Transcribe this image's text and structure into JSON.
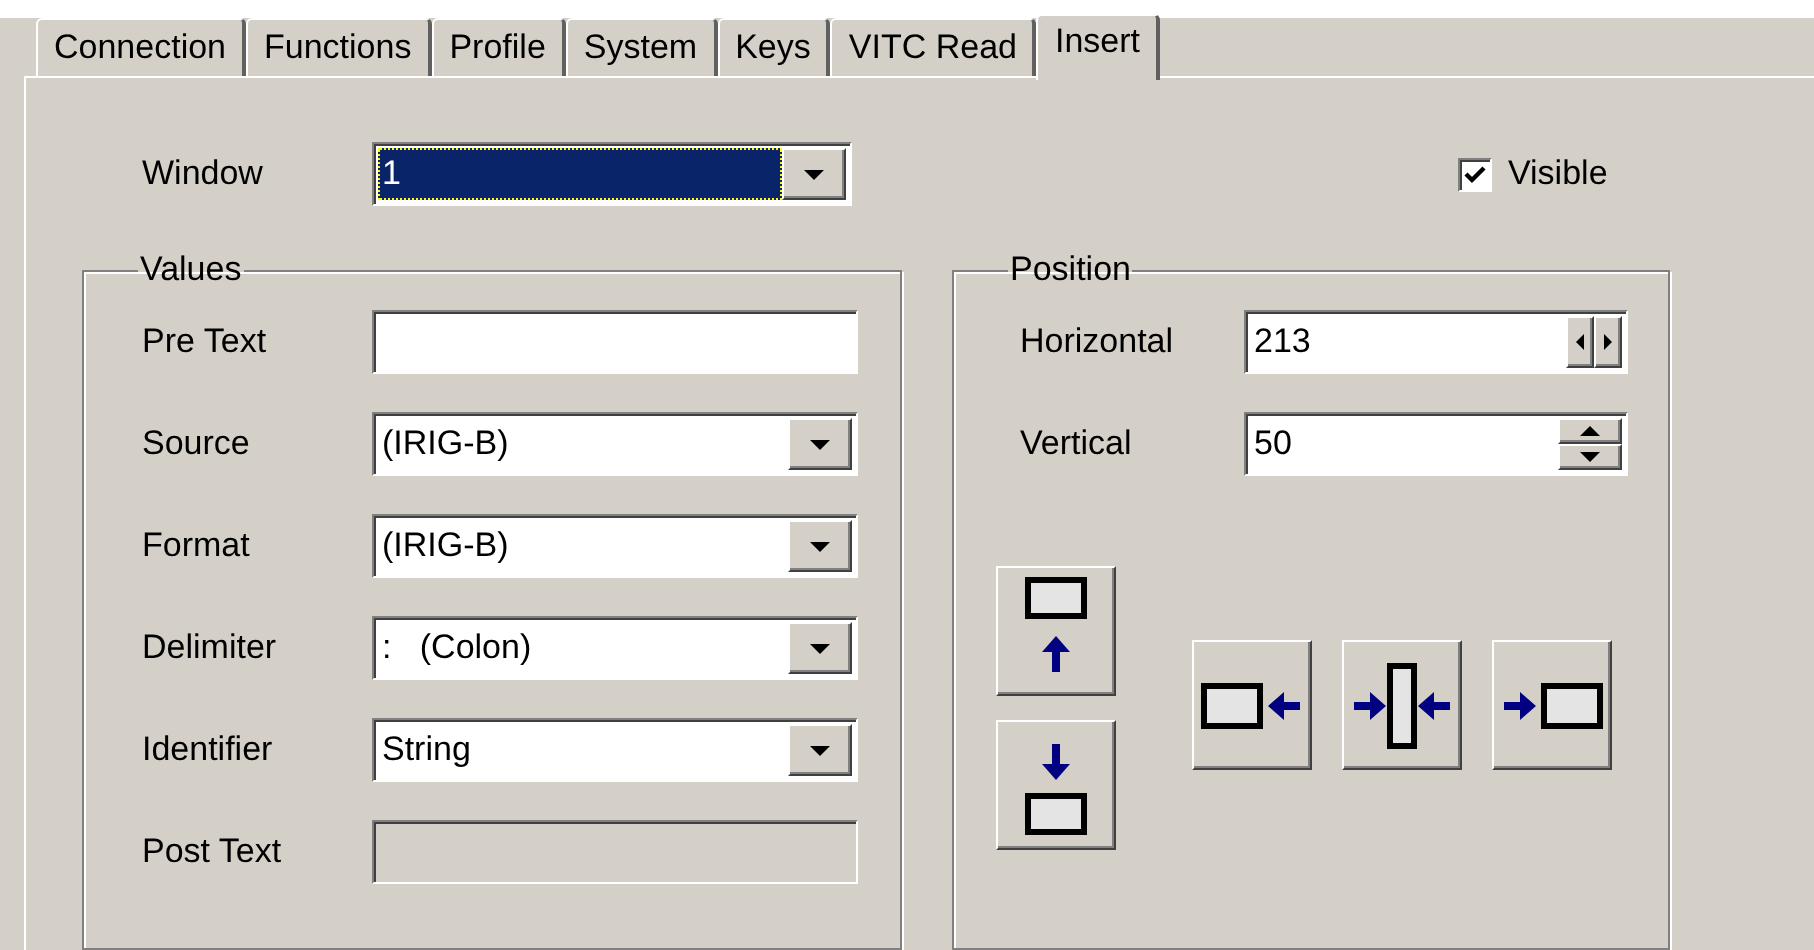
{
  "tabs": [
    {
      "label": "Connection",
      "selected": false
    },
    {
      "label": "Functions",
      "selected": false
    },
    {
      "label": "Profile",
      "selected": false
    },
    {
      "label": "System",
      "selected": false
    },
    {
      "label": "Keys",
      "selected": false
    },
    {
      "label": "VITC Read",
      "selected": false
    },
    {
      "label": "Insert",
      "selected": true
    }
  ],
  "window": {
    "label": "Window",
    "value": "1",
    "focused": true
  },
  "visible": {
    "label": "Visible",
    "checked": true
  },
  "values": {
    "title": "Values",
    "fields": [
      {
        "kind": "text",
        "label": "Pre Text",
        "disabled": false
      },
      {
        "kind": "combo",
        "label": "Source",
        "value": "(IRIG-B)",
        "disabled": false
      },
      {
        "kind": "combo",
        "label": "Format",
        "value": "(IRIG-B)",
        "disabled": false
      },
      {
        "kind": "combo",
        "label": "Delimiter",
        "value": ":   (Colon)",
        "disabled": false
      },
      {
        "kind": "combo",
        "label": "Identifier",
        "value": "String",
        "disabled": false
      },
      {
        "kind": "text",
        "label": "Post Text",
        "disabled": true
      }
    ]
  },
  "position": {
    "title": "Position",
    "spinners": [
      {
        "kind": "horizontal",
        "label": "Horizontal",
        "value": "213"
      },
      {
        "kind": "vertical",
        "label": "Vertical",
        "value": "50"
      }
    ]
  }
}
